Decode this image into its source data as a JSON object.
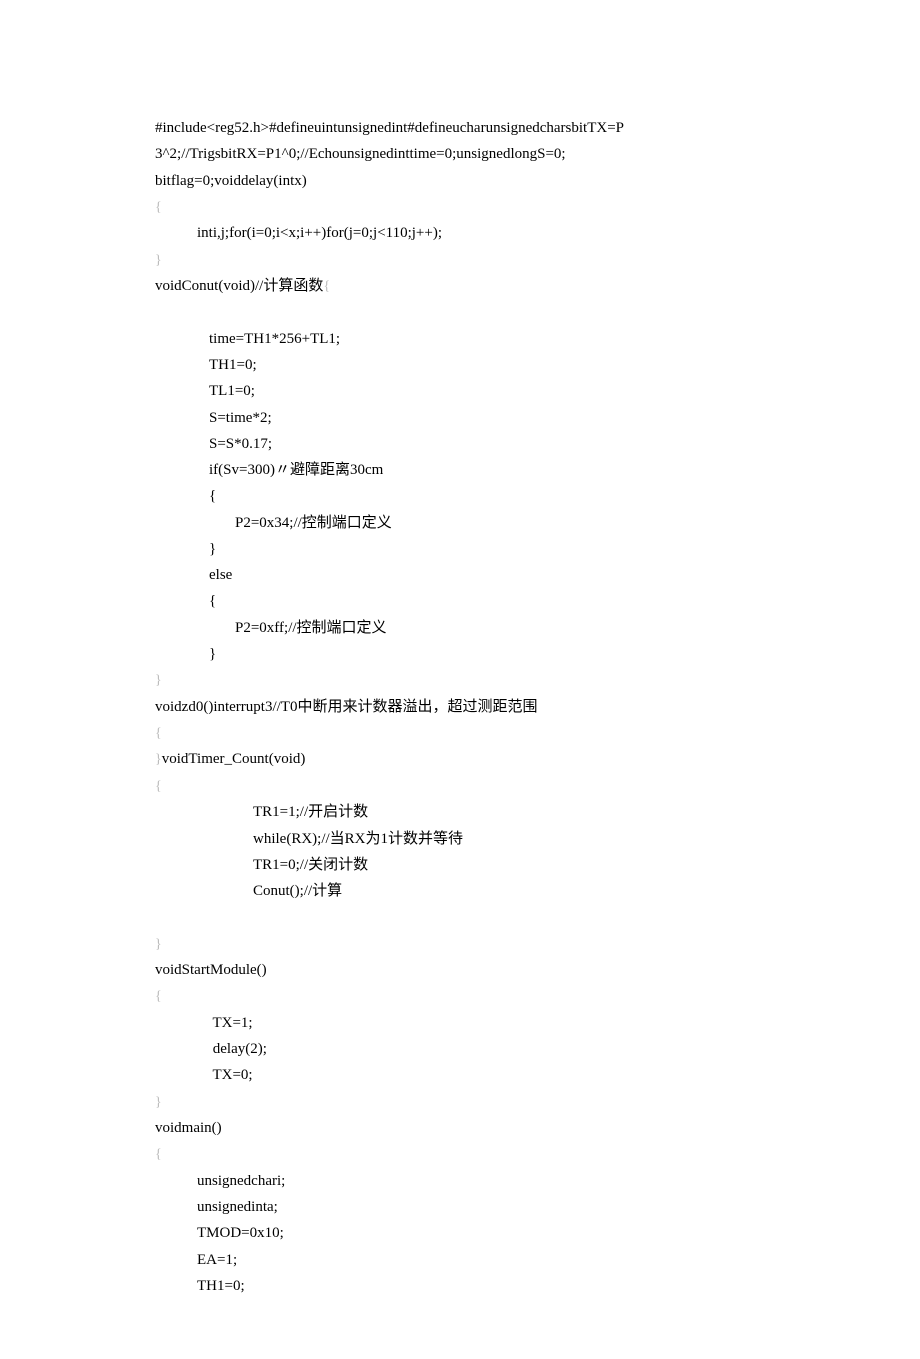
{
  "lines": [
    {
      "cls": "",
      "text": "#include<reg52.h>#defineuintunsignedint#defineucharunsignedcharsbitTX=P",
      "brace": false
    },
    {
      "cls": "",
      "text": "3^2;//TrigsbitRX=P1^0;//Echounsignedinttime=0;unsignedlongS=0;",
      "brace": false
    },
    {
      "cls": "",
      "text": "bitflag=0;voiddelay(intx)",
      "brace": false
    },
    {
      "cls": "",
      "text": "{",
      "brace": true
    },
    {
      "cls": "i1",
      "text": "inti,j;for(i=0;i<x;i++)for(j=0;j<110;j++);",
      "brace": false
    },
    {
      "cls": "",
      "text": "}",
      "brace": true
    },
    {
      "cls": "",
      "text": "voidConut(void)//计算函数{",
      "brace": false,
      "trailingBrace": true
    },
    {
      "cls": "",
      "text": "",
      "brace": false
    },
    {
      "cls": "i1b",
      "text": "time=TH1*256+TL1;",
      "brace": false
    },
    {
      "cls": "i1b",
      "text": "TH1=0;",
      "brace": false
    },
    {
      "cls": "i1b",
      "text": "TL1=0;",
      "brace": false
    },
    {
      "cls": "i1b",
      "text": "S=time*2;",
      "brace": false
    },
    {
      "cls": "i1b",
      "text": "S=S*0.17;",
      "brace": false
    },
    {
      "cls": "i1b",
      "text": "if(Sv=300)〃避障距离30cm",
      "brace": false
    },
    {
      "cls": "i1b",
      "text": "{",
      "brace": false
    },
    {
      "cls": "i2",
      "text": "P2=0x34;//控制端口定义",
      "brace": false
    },
    {
      "cls": "i1b",
      "text": "}",
      "brace": false
    },
    {
      "cls": "i1b",
      "text": "else",
      "brace": false
    },
    {
      "cls": "i1b",
      "text": "{",
      "brace": false
    },
    {
      "cls": "i2",
      "text": "P2=0xff;//控制端口定义",
      "brace": false
    },
    {
      "cls": "i1b",
      "text": "}",
      "brace": false
    },
    {
      "cls": "",
      "text": "}",
      "brace": true
    },
    {
      "cls": "",
      "text": "voidzd0()interrupt3//T0中断用来计数器溢出，超过测距范围",
      "brace": false
    },
    {
      "cls": "",
      "text": "{",
      "brace": true
    },
    {
      "cls": "",
      "text": "}voidTimer_Count(void)",
      "brace": false,
      "leadingBrace": true
    },
    {
      "cls": "",
      "text": "{",
      "brace": true
    },
    {
      "cls": "i3",
      "text": "TR1=1;//开启计数",
      "brace": false
    },
    {
      "cls": "i3",
      "text": "while(RX);//当RX为1计数并等待",
      "brace": false
    },
    {
      "cls": "i3",
      "text": "TR1=0;//关闭计数",
      "brace": false
    },
    {
      "cls": "i3",
      "text": "Conut();//计算",
      "brace": false
    },
    {
      "cls": "",
      "text": "",
      "brace": false
    },
    {
      "cls": "",
      "text": "}",
      "brace": true
    },
    {
      "cls": "",
      "text": "voidStartModule()",
      "brace": false
    },
    {
      "cls": "",
      "text": "{",
      "brace": true
    },
    {
      "cls": "i1b",
      "text": " TX=1;",
      "brace": false
    },
    {
      "cls": "i1b",
      "text": " delay(2);",
      "brace": false
    },
    {
      "cls": "i1b",
      "text": " TX=0;",
      "brace": false
    },
    {
      "cls": "",
      "text": "}",
      "brace": true
    },
    {
      "cls": "",
      "text": "voidmain()",
      "brace": false
    },
    {
      "cls": "",
      "text": "{",
      "brace": true
    },
    {
      "cls": "i1",
      "text": "unsignedchari;",
      "brace": false
    },
    {
      "cls": "i1",
      "text": "unsignedinta;",
      "brace": false
    },
    {
      "cls": "i1",
      "text": "TMOD=0x10;",
      "brace": false
    },
    {
      "cls": "i1",
      "text": "EA=1;",
      "brace": false
    },
    {
      "cls": "i1",
      "text": "TH1=0;",
      "brace": false
    }
  ]
}
